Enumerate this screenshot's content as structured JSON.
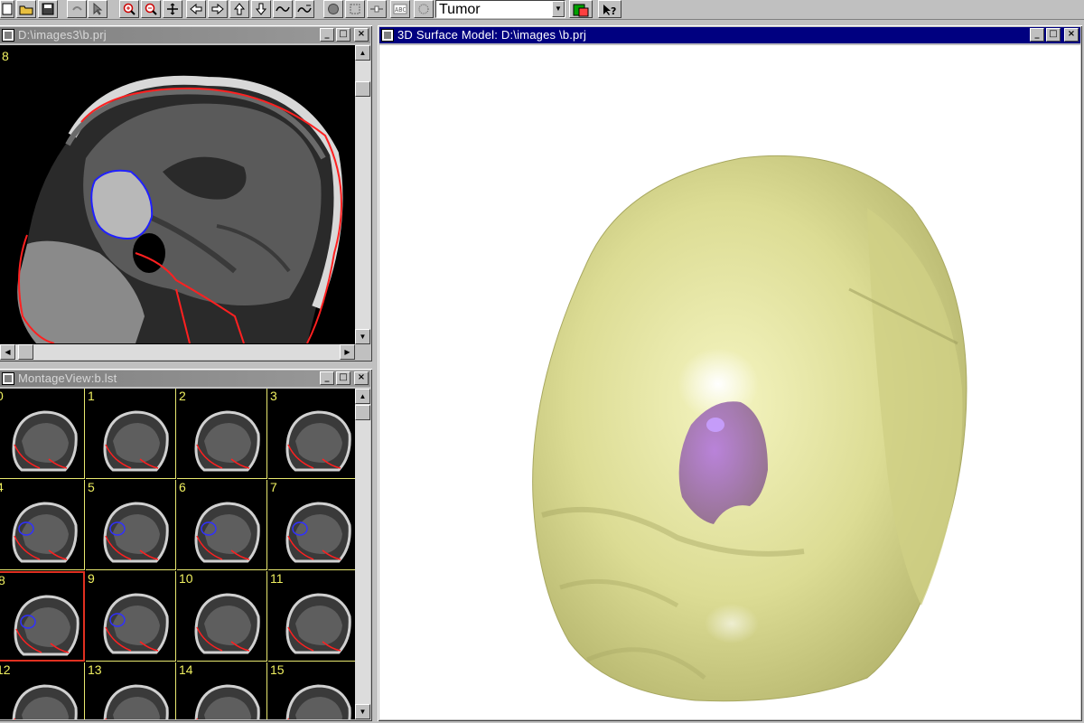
{
  "toolbar": {
    "structure_select": "Tumor",
    "buttons": [
      "open-icon",
      "save-icon",
      "undo-icon",
      "pointer-icon",
      "zoom-in-icon",
      "zoom-out-icon",
      "pan-icon",
      "arrow-left-icon",
      "arrow-right-icon",
      "arrow-up-icon",
      "arrow-down-icon",
      "wave-icon",
      "wave2-icon",
      "blob-icon",
      "box-icon",
      "line-icon",
      "text-icon",
      "color-icon",
      "help-icon"
    ]
  },
  "slice_window": {
    "title": "D:\\images3\\b.prj",
    "slice_number": "8",
    "controls": [
      "_",
      "□",
      "×"
    ]
  },
  "montage_window": {
    "title": "MontageView:b.lst",
    "controls": [
      "_",
      "□",
      "×"
    ],
    "cells": [
      {
        "label": "0"
      },
      {
        "label": "1"
      },
      {
        "label": "2"
      },
      {
        "label": "3"
      },
      {
        "label": "4"
      },
      {
        "label": "5"
      },
      {
        "label": "6"
      },
      {
        "label": "7"
      },
      {
        "label": "8"
      },
      {
        "label": "9"
      },
      {
        "label": "10"
      },
      {
        "label": "11"
      },
      {
        "label": "12"
      },
      {
        "label": "13"
      },
      {
        "label": "14"
      },
      {
        "label": "15"
      }
    ],
    "selected": "8"
  },
  "model_window": {
    "title": "3D Surface Model: D:\\images \\b.prj",
    "controls": [
      "_",
      "□",
      "×"
    ],
    "colors": {
      "skin": "#d9d98a",
      "tumor": "#9a6ab0",
      "background": "#ffffff"
    }
  }
}
